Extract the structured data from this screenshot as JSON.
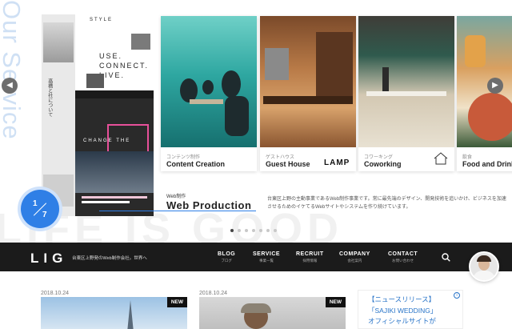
{
  "hero": {
    "vertical_title": "Our Service",
    "background_word": "LIFE IS GOOD",
    "counter": {
      "current": "1",
      "total": "7"
    },
    "web_production": {
      "label_jp": "Web制作",
      "label_en": "Web Production",
      "description": "台東区上野の主動事業であるWeb制作事業です。常に最先端のデザイン、開発技術を追いかけ、ビジネスを加速させるためのイケてるWebサイトやシステムを作り続けています。"
    },
    "collage": {
      "style_title": "STYLE",
      "side_text": "高橋と社について",
      "big_lines": [
        "USE.",
        "CONNECT.",
        "LIVE."
      ],
      "change_text": "CHANGE THE"
    },
    "cards": [
      {
        "jp": "コンテンツ制作",
        "en": "Content Creation"
      },
      {
        "jp": "ゲストハウス",
        "en": "Guest House",
        "logo": "LAMP"
      },
      {
        "jp": "コワーキング",
        "en": "Coworking"
      },
      {
        "jp": "飲食",
        "en": "Food and Drink"
      }
    ],
    "dots": {
      "count": 7,
      "active_index": 0
    }
  },
  "nav": {
    "logo": "LIG",
    "tagline": "台東区上野発のWeb制作会社。世界へ",
    "items": [
      {
        "en": "BLOG",
        "jp": "ブログ"
      },
      {
        "en": "SERVICE",
        "jp": "事業一覧"
      },
      {
        "en": "RECRUIT",
        "jp": "採用情報"
      },
      {
        "en": "COMPANY",
        "jp": "会社案内"
      },
      {
        "en": "CONTACT",
        "jp": "お問い合わせ"
      }
    ],
    "icons": {
      "search": "search-icon"
    }
  },
  "articles": [
    {
      "date": "2018.10.24",
      "badge": "NEW"
    },
    {
      "date": "2018.10.24",
      "badge": "NEW"
    }
  ],
  "ad": {
    "line1": "【ニュースリリース】",
    "line2": "「SAJIKI WEDDING」",
    "line3": "オフィシャルサイトが",
    "info": "i"
  },
  "colors": {
    "accent_blue": "#2f7fe6",
    "nav_bg": "#1b1b1b",
    "ad_blue": "#2874c8"
  }
}
